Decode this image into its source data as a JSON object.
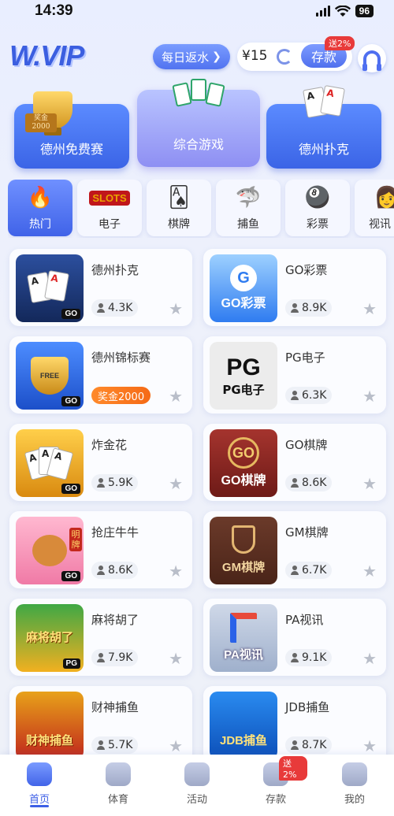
{
  "status": {
    "time": "14:39",
    "battery": "96"
  },
  "header": {
    "logo": "W.VIP",
    "rebate_label": "每日返水",
    "balance": "¥15",
    "deposit_label": "存款",
    "deposit_badge": "送2%"
  },
  "top_categories": [
    {
      "label": "德州免费赛",
      "prize_tag": "奖金\n2000"
    },
    {
      "label": "综合游戏"
    },
    {
      "label": "德州扑克"
    }
  ],
  "sub_categories": [
    "热门",
    "电子",
    "棋牌",
    "捕鱼",
    "彩票",
    "视讯"
  ],
  "thumb_texts": {
    "go_lottery": "GO彩票",
    "pg": "PG",
    "pg_sub": "PG电子",
    "go_chess": "GO棋牌",
    "gm_chess": "GM棋牌",
    "pa": "PA视讯",
    "jdb": "JDB捕鱼",
    "mahjong": "麻将胡了",
    "caishen": "财神捕鱼",
    "mingpai": "明牌",
    "go": "GO",
    "pg_small": "PG",
    "free": "FREE",
    "slots": "SLOTS",
    "ace": "A"
  },
  "games": [
    {
      "name": "德州扑克",
      "players": "4.3K"
    },
    {
      "name": "GO彩票",
      "players": "8.9K"
    },
    {
      "name": "德州锦标赛",
      "prize": "奖金2000"
    },
    {
      "name": "PG电子",
      "players": "6.3K"
    },
    {
      "name": "炸金花",
      "players": "5.9K"
    },
    {
      "name": "GO棋牌",
      "players": "8.6K"
    },
    {
      "name": "抢庄牛牛",
      "players": "8.6K"
    },
    {
      "name": "GM棋牌",
      "players": "6.7K"
    },
    {
      "name": "麻将胡了",
      "players": "7.9K"
    },
    {
      "name": "PA视讯",
      "players": "9.1K"
    },
    {
      "name": "财神捕鱼",
      "players": "5.7K"
    },
    {
      "name": "JDB捕鱼",
      "players": "8.7K"
    }
  ],
  "bottom_nav": [
    {
      "label": "首页"
    },
    {
      "label": "体育"
    },
    {
      "label": "活动"
    },
    {
      "label": "存款",
      "badge": "送2%"
    },
    {
      "label": "我的"
    }
  ],
  "colors": {
    "accent": "#4264e8",
    "badge": "#e83a3a",
    "prize": "#f56a16"
  },
  "icons": [
    "flame-icon",
    "slots-icon",
    "cards-icon",
    "fish-icon",
    "lottery-balls-icon",
    "live-dealer-icon",
    "star-icon",
    "headset-icon",
    "refresh-icon",
    "person-icon"
  ]
}
